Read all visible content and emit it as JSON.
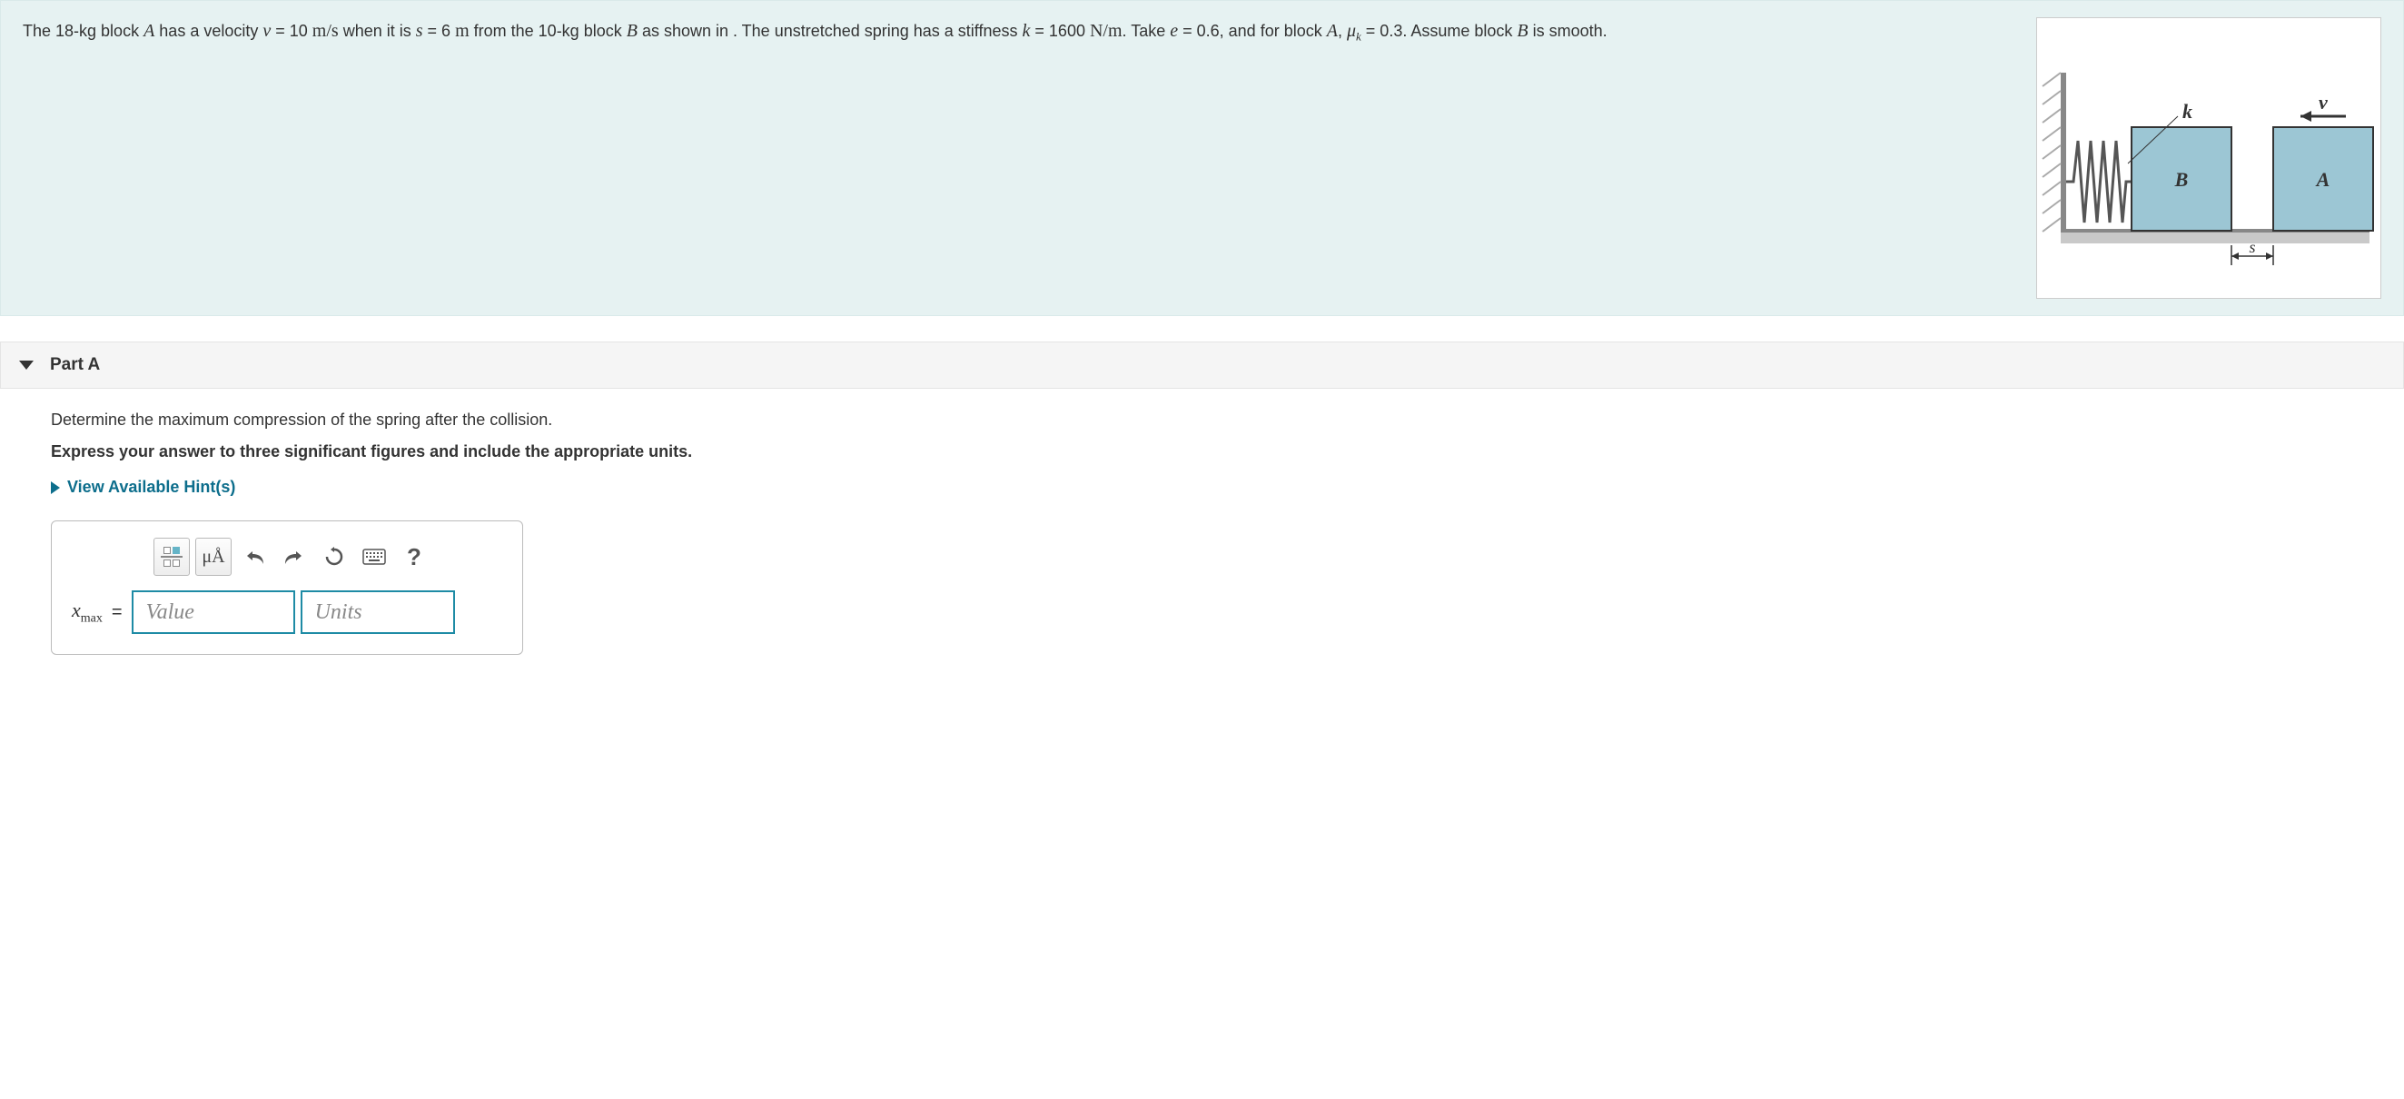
{
  "problem": {
    "text_pre": "The 18-kg block ",
    "varA": "A",
    "text2": " has a velocity ",
    "var_v": "v",
    "text3": " = 10 ",
    "unit_v": "m/s",
    "text4": " when it is ",
    "var_s": "s",
    "text5": " = 6 ",
    "unit_s": "m",
    "text6": " from the 10-kg block ",
    "varB": "B",
    "text7": " as shown in . The unstretched spring has a stiffness ",
    "var_k": "k",
    "text8": " = 1600 ",
    "unit_k": "N/m",
    "text9": ". Take ",
    "var_e": "e",
    "text10": " = 0.6, and for block ",
    "varA2": "A",
    "text11": ", ",
    "var_mu": "μ",
    "mu_sub": "k",
    "text12": " = 0.3. Assume block ",
    "varB2": "B",
    "text13": " is smooth."
  },
  "figure": {
    "k": "k",
    "v": "v",
    "B": "B",
    "A": "A",
    "s": "s"
  },
  "part": {
    "label": "Part A",
    "question": "Determine the maximum compression of the spring after the collision.",
    "instruction": "Express your answer to three significant figures and include the appropriate units.",
    "hints": "View Available Hint(s)"
  },
  "toolbar": {
    "templates": "templates",
    "mua": "μÅ",
    "undo": "undo",
    "redo": "redo",
    "reset": "reset",
    "keyboard": "keyboard",
    "help": "?"
  },
  "answer": {
    "var": "x",
    "sub": "max",
    "eq": "=",
    "value_ph": "Value",
    "units_ph": "Units"
  }
}
